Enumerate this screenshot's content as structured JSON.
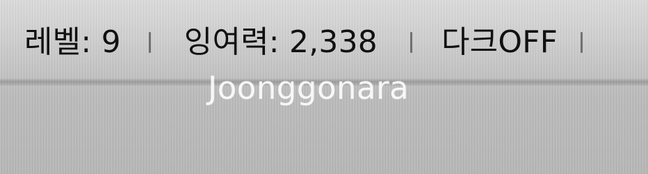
{
  "status": {
    "level_text": "레벨: 9",
    "surplus_text": "잉여력: 2,338",
    "dark_mode_text": "다크OFF"
  },
  "watermark": {
    "text": "Joonggonara"
  },
  "colors": {
    "background": "#bdbdbd",
    "text": "#111111",
    "watermark": "#ffffff"
  }
}
